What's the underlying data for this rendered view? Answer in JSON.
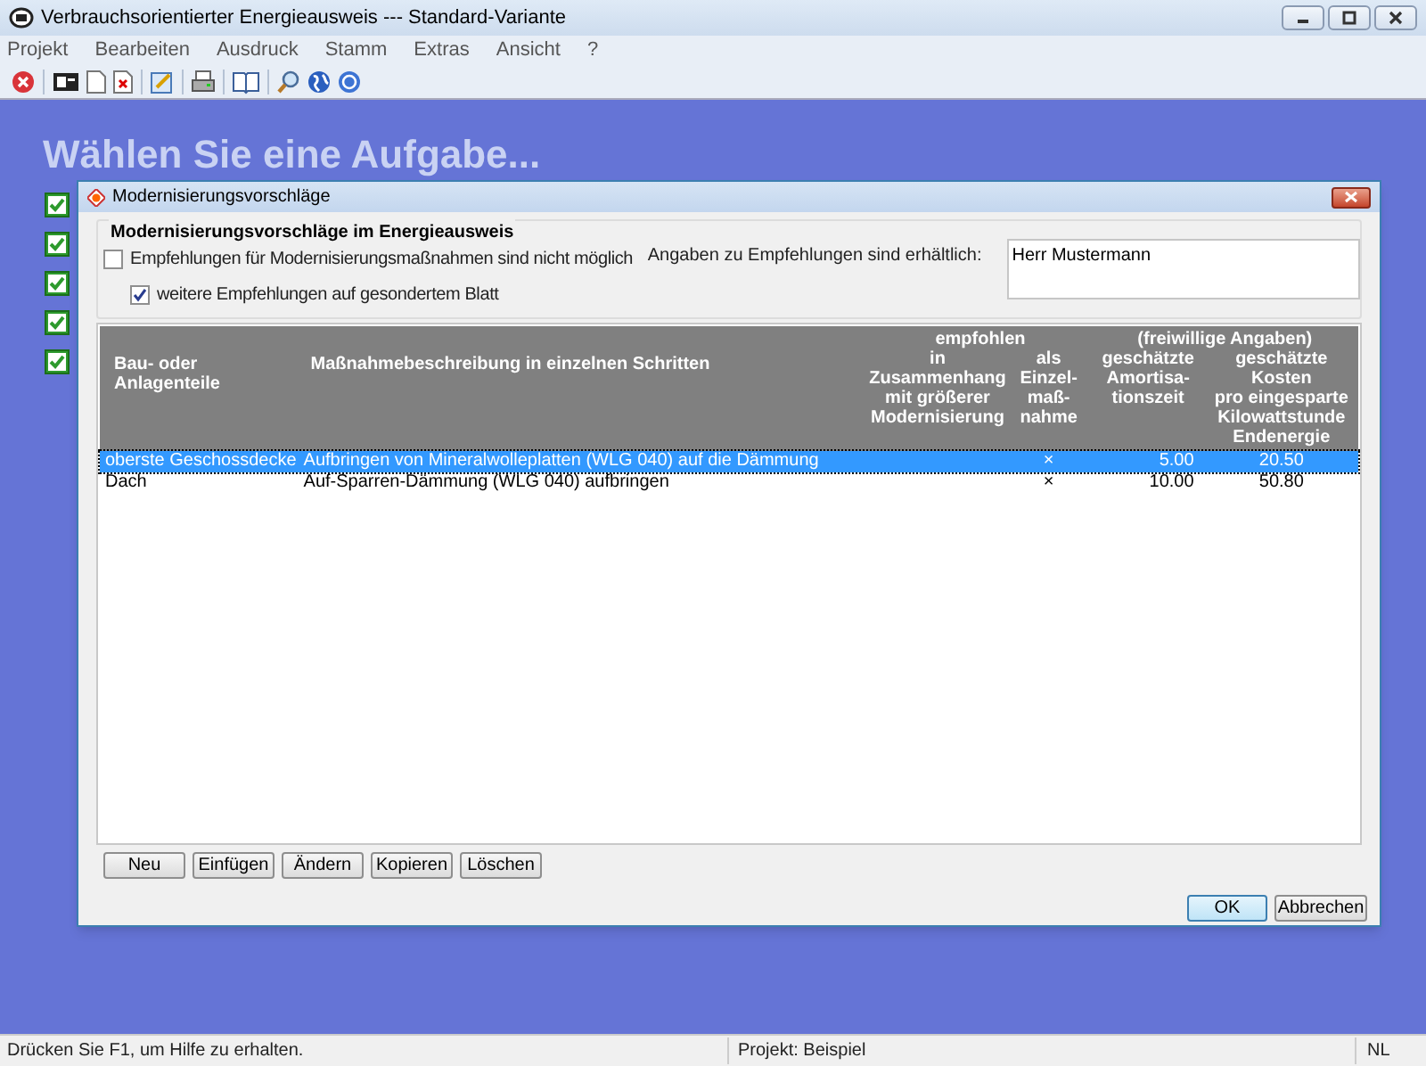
{
  "window": {
    "title": "Verbrauchsorientierter Energieausweis --- Standard-Variante"
  },
  "menu": [
    "Projekt",
    "Bearbeiten",
    "Ausdruck",
    "Stamm",
    "Extras",
    "Ansicht",
    "?"
  ],
  "heading": "Wählen Sie eine Aufgabe...",
  "tasks": [
    {
      "checked": true
    },
    {
      "checked": true
    },
    {
      "checked": true
    },
    {
      "checked": true
    },
    {
      "checked": true
    }
  ],
  "dialog": {
    "title": "Modernisierungsvorschläge",
    "group_title": "Modernisierungsvorschläge im Energieausweis",
    "options": [
      {
        "label": "Empfehlungen für Modernisierungsmaßnahmen sind nicht möglich",
        "checked": false
      },
      {
        "label": "weitere Empfehlungen auf gesondertem Blatt",
        "checked": true
      }
    ],
    "contact_label": "Angaben zu Empfehlungen sind erhältlich:",
    "contact_value": "Herr Mustermann",
    "table": {
      "column_groups": [
        {
          "colspan": 2
        },
        {
          "label": "empfohlen",
          "colspan": 2
        },
        {
          "label": "(freiwillige Angaben)",
          "colspan": 2
        }
      ],
      "columns": [
        {
          "label": "Bau- oder\nAnlagenteile"
        },
        {
          "label": "Maßnahmebeschreibung in einzelnen Schritten"
        },
        {
          "label": "in\nZusammenhang\nmit größerer\nModernisierung"
        },
        {
          "label": "als\nEinzel-\nmaß-\nnahme"
        },
        {
          "label": "geschätzte\nAmortisa-\ntionszeit"
        },
        {
          "label": "geschätzte\nKosten\npro eingesparte\nKilowattstunde\nEndenergie"
        }
      ],
      "rows": [
        {
          "selected": true,
          "cells": [
            "oberste Geschossdecke",
            "Aufbringen von Mineralwolleplatten (WLG 040) auf die Dämmung",
            "",
            "×",
            "5.00",
            "20.50"
          ]
        },
        {
          "selected": false,
          "cells": [
            "Dach",
            "Auf-Sparren-Dämmung (WLG 040) aufbringen",
            "",
            "×",
            "10.00",
            "50.80"
          ]
        }
      ]
    },
    "list_buttons": [
      "Neu",
      "Einfügen",
      "Ändern",
      "Kopieren",
      "Löschen"
    ],
    "buttons": [
      {
        "label": "OK",
        "default": true
      },
      {
        "label": "Abbrechen",
        "default": false
      }
    ]
  },
  "status_bar": [
    "Drücken Sie F1, um Hilfe zu erhalten.",
    "Projekt: Beispiel",
    "NL"
  ]
}
